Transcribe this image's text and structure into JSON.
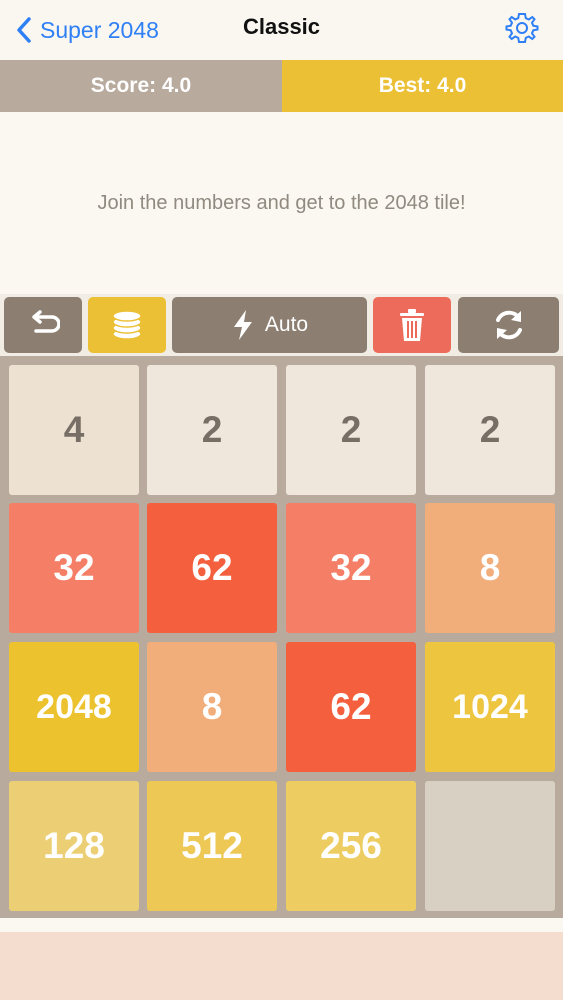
{
  "nav": {
    "back_label": "Super 2048",
    "title": "Classic",
    "back_icon": "chevron-left-icon",
    "settings_icon": "gear-icon",
    "accent": "#2f7ff5"
  },
  "scores": {
    "score_label": "Score: 4.0",
    "best_label": "Best: 4.0"
  },
  "hint": "Join the numbers and get to the 2048 tile!",
  "toolbar": {
    "auto_label": "Auto",
    "undo_icon": "undo-icon",
    "coins_icon": "coins-icon",
    "auto_icon": "lightning-bolt-icon",
    "trash_icon": "trash-icon",
    "refresh_icon": "refresh-icon"
  },
  "board": {
    "rows": [
      [
        "4",
        "2",
        "2",
        "2"
      ],
      [
        "32",
        "62",
        "32",
        "8"
      ],
      [
        "2048",
        "8",
        "62",
        "1024"
      ],
      [
        "128",
        "512",
        "256",
        ""
      ]
    ]
  },
  "colors": {
    "score_bg": "#b8ab9e",
    "best_bg": "#ebc034",
    "board_bg": "#b8ab9e",
    "button_bg": "#8c7f72",
    "trash_bg": "#ec6b5a",
    "tile_2": "#efe6dc",
    "tile_4": "#ede2d1",
    "tile_8": "#f1ad7a",
    "tile_32": "#f57e67",
    "tile_62": "#f4603e",
    "tile_128": "#eccf74",
    "tile_256": "#edcd61",
    "tile_512": "#edc854",
    "tile_1024": "#edc53f",
    "tile_2048": "#ecc22e",
    "tile_empty": "#d9d0c4"
  }
}
